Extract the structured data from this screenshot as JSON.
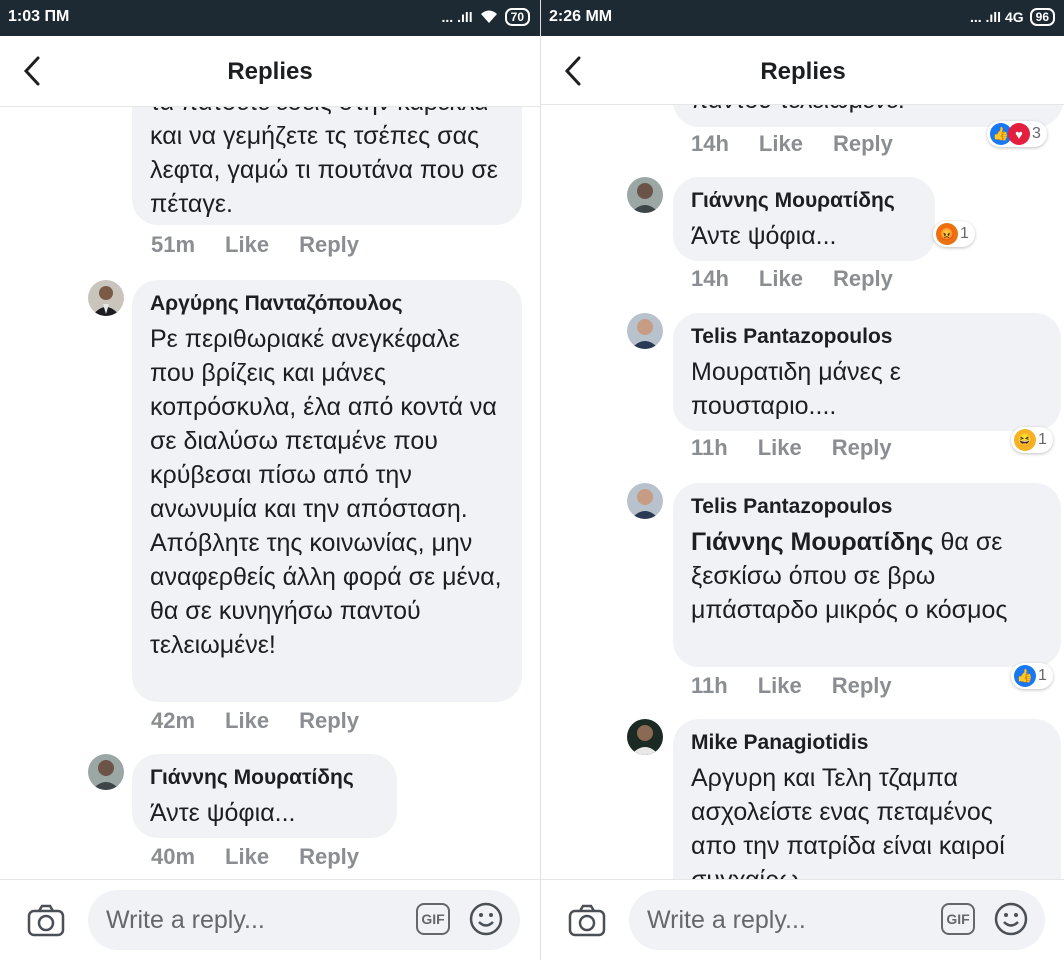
{
  "left": {
    "status": {
      "time": "1:03 ΠΜ",
      "signal": "... .ıll",
      "battery": "70"
    },
    "header": {
      "title": "Replies"
    },
    "comments": [
      {
        "author": "",
        "text": "τα πάτσετε εσείς στην καρέκλα και να γεμήζετε τς τσέπες σας λεφτα, γαμώ τι πουτάνα που σε πέταγε.",
        "time": "51m",
        "like": "Like",
        "reply": "Reply"
      },
      {
        "author": "Αργύρης Πανταζόπουλος",
        "text": "Ρε περιθωριακέ ανεγκέφαλε που βρίζεις και μάνες κοπρόσκυλα, έλα από κοντά να σε διαλύσω πεταμένε που κρύβεσαι πίσω από την ανωνυμία και την απόσταση. Απόβλητε της κοινωνίας, μην αναφερθείς άλλη φορά σε μένα, θα σε κυνηγήσω παντού τελειωμένε!",
        "time": "42m",
        "like": "Like",
        "reply": "Reply"
      },
      {
        "author": "Γιάννης Μουρατίδης",
        "text": "Άντε ψόφια...",
        "time": "40m",
        "like": "Like",
        "reply": "Reply"
      }
    ],
    "composer": {
      "placeholder": "Write a reply...",
      "gif": "GIF"
    }
  },
  "right": {
    "status": {
      "time": "2:26 ΜΜ",
      "signal": "... .ıll 4G",
      "battery": "96"
    },
    "header": {
      "title": "Replies"
    },
    "comments": [
      {
        "author": "",
        "text": "παντού τελειωμένε!",
        "time": "14h",
        "like": "Like",
        "reply": "Reply",
        "reaction_count": "3"
      },
      {
        "author": "Γιάννης Μουρατίδης",
        "text": "Άντε ψόφια...",
        "time": "14h",
        "like": "Like",
        "reply": "Reply",
        "reaction_count": "1"
      },
      {
        "author": "Telis Pantazopoulos",
        "text": "Μουρατιδη μάνες ε πουσταριο....",
        "time": "11h",
        "like": "Like",
        "reply": "Reply",
        "reaction_count": "1"
      },
      {
        "author": "Telis Pantazopoulos",
        "mention": "Γιάννης Μουρατίδης",
        "text": " θα σε ξεσκίσω όπου σε βρω μπάσταρδο μικρός ο κόσμος",
        "time": "11h",
        "like": "Like",
        "reply": "Reply",
        "reaction_count": "1"
      },
      {
        "author": "Mike Panagiotidis",
        "text": "Αργυρη και Τελη τζαμπα ασχολείστε ενας πεταμένος απο την πατρίδα είναι καιροί συγχαίρω",
        "time": "",
        "like": "",
        "reply": ""
      }
    ],
    "composer": {
      "placeholder": "Write a reply...",
      "gif": "GIF"
    }
  },
  "colors": {
    "bubble": "#f0f2f5",
    "meta": "#8a8d91",
    "like_blue": "#1877f2",
    "love_red": "#e41e3f",
    "status_bar": "#1e2a33"
  }
}
